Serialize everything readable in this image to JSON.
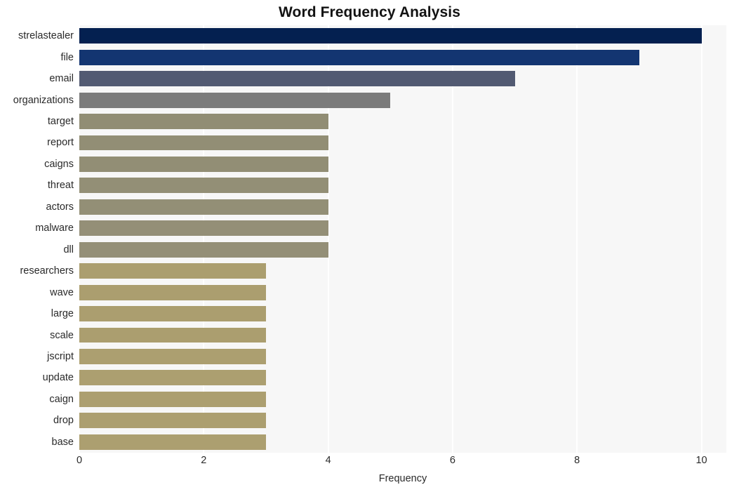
{
  "chart_data": {
    "type": "bar",
    "orientation": "horizontal",
    "title": "Word Frequency Analysis",
    "xlabel": "Frequency",
    "ylabel": "",
    "xlim": [
      0,
      10.4
    ],
    "xticks": [
      0,
      2,
      4,
      6,
      8,
      10
    ],
    "xtick_labels": [
      "0",
      "2",
      "4",
      "6",
      "8",
      "10"
    ],
    "grid": "vertical-white-on-light-gray",
    "legend": "none",
    "categories": [
      "strelastealer",
      "file",
      "email",
      "organizations",
      "target",
      "report",
      "caigns",
      "threat",
      "actors",
      "malware",
      "dll",
      "researchers",
      "wave",
      "large",
      "scale",
      "jscript",
      "update",
      "caign",
      "drop",
      "base"
    ],
    "values": [
      10,
      9,
      7,
      5,
      4,
      4,
      4,
      4,
      4,
      4,
      4,
      3,
      3,
      3,
      3,
      3,
      3,
      3,
      3,
      3
    ],
    "bar_colors": [
      "#042050",
      "#133571",
      "#525a72",
      "#7b7b7b",
      "#918d74",
      "#928e75",
      "#928e75",
      "#938f76",
      "#938f76",
      "#948f77",
      "#948f77",
      "#ab9e6f",
      "#ab9e6f",
      "#ab9e6f",
      "#ab9e6f",
      "#ac9f70",
      "#ac9f70",
      "#ac9f70",
      "#ac9f70",
      "#ac9f70"
    ],
    "plot_background": "#f7f7f7",
    "figure_background": "#ffffff",
    "gridline_color": "#ffffff",
    "text_color": "#2a2a2a",
    "title_color": "#121212"
  }
}
